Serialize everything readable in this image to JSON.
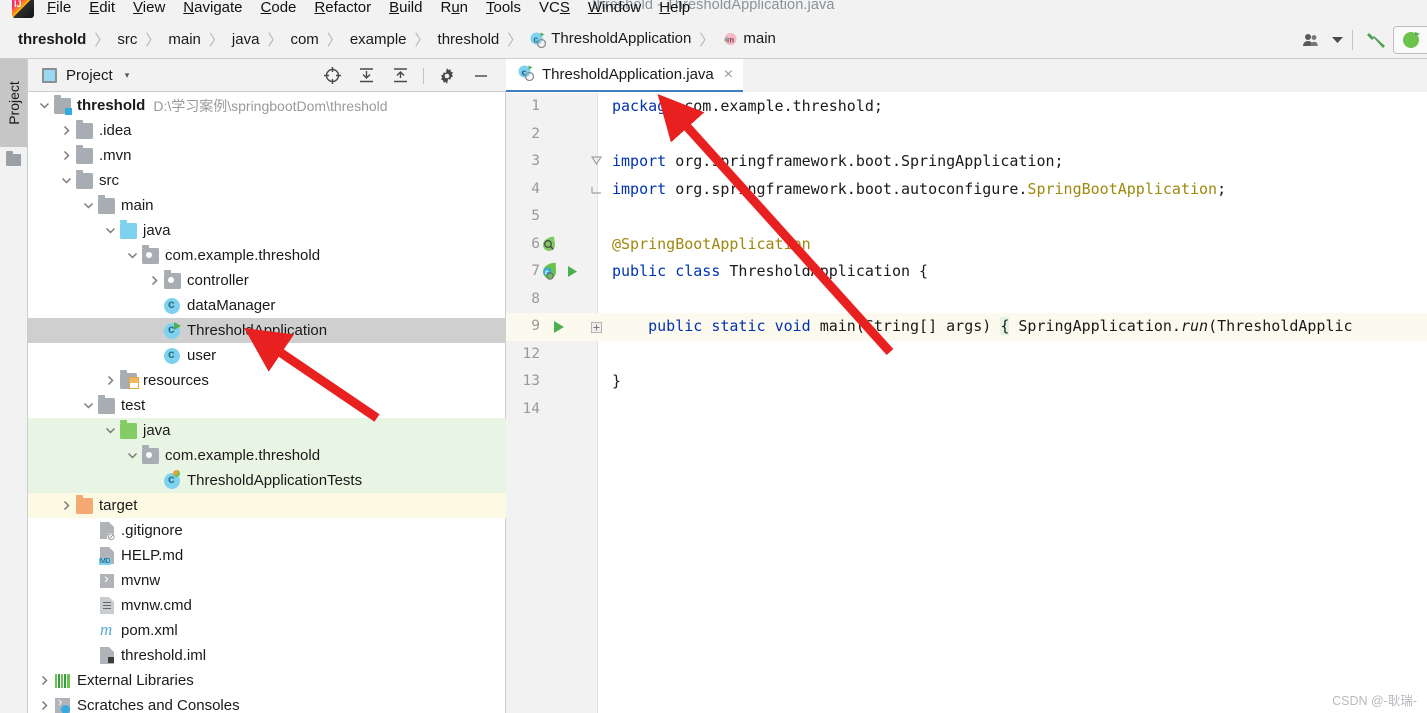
{
  "window": {
    "title": "threshold - ThresholdApplication.java"
  },
  "menubar": {
    "items": [
      {
        "label": "File",
        "mnemonic": "F"
      },
      {
        "label": "Edit",
        "mnemonic": "E"
      },
      {
        "label": "View",
        "mnemonic": "V"
      },
      {
        "label": "Navigate",
        "mnemonic": "N"
      },
      {
        "label": "Code",
        "mnemonic": "C"
      },
      {
        "label": "Refactor",
        "mnemonic": "R"
      },
      {
        "label": "Build",
        "mnemonic": "B"
      },
      {
        "label": "Run",
        "mnemonic": "u"
      },
      {
        "label": "Tools",
        "mnemonic": "T"
      },
      {
        "label": "VCS",
        "mnemonic": "S"
      },
      {
        "label": "Window",
        "mnemonic": "W"
      },
      {
        "label": "Help",
        "mnemonic": "H"
      }
    ]
  },
  "breadcrumb": {
    "items": [
      {
        "label": "threshold",
        "bold": true,
        "icon": null
      },
      {
        "label": "src",
        "bold": false,
        "icon": null
      },
      {
        "label": "main",
        "bold": false,
        "icon": null
      },
      {
        "label": "java",
        "bold": false,
        "icon": null
      },
      {
        "label": "com",
        "bold": false,
        "icon": null
      },
      {
        "label": "example",
        "bold": false,
        "icon": null
      },
      {
        "label": "threshold",
        "bold": false,
        "icon": null
      },
      {
        "label": "ThresholdApplication",
        "bold": false,
        "icon": "java-class-run-icon"
      },
      {
        "label": "main",
        "bold": false,
        "icon": "method-icon"
      }
    ],
    "separator": "〉"
  },
  "toolbar_right": {
    "user_icon": "user-group-icon",
    "user_caret": "▾",
    "build_icon": "build-hammer-icon",
    "run_icon": "run-configuration-icon"
  },
  "left_strip": {
    "project_tab": "Project"
  },
  "project_panel": {
    "title": "Project",
    "caret": "▾",
    "icons": [
      {
        "name": "locate-icon",
        "glyph": "⊕"
      },
      {
        "name": "expand-all-icon",
        "glyph": "⤓"
      },
      {
        "name": "collapse-all-icon",
        "glyph": "⤒"
      },
      {
        "name": "settings-gear-icon",
        "glyph": "⚙"
      },
      {
        "name": "hide-panel-icon",
        "glyph": "—"
      }
    ],
    "tree": [
      {
        "label": "threshold",
        "sub": "D:\\学习案例\\springbootDom\\threshold",
        "indent": 0,
        "arrow": "down",
        "icon": "module-folder",
        "bold": true,
        "hl": "none"
      },
      {
        "label": ".idea",
        "sub": "",
        "indent": 1,
        "arrow": "right",
        "icon": "folder-gray",
        "bold": false,
        "hl": "none"
      },
      {
        "label": ".mvn",
        "sub": "",
        "indent": 1,
        "arrow": "right",
        "icon": "folder-gray",
        "bold": false,
        "hl": "none"
      },
      {
        "label": "src",
        "sub": "",
        "indent": 1,
        "arrow": "down",
        "icon": "folder-gray",
        "bold": false,
        "hl": "none"
      },
      {
        "label": "main",
        "sub": "",
        "indent": 2,
        "arrow": "down",
        "icon": "folder-gray",
        "bold": false,
        "hl": "none"
      },
      {
        "label": "java",
        "sub": "",
        "indent": 3,
        "arrow": "down",
        "icon": "folder-blue",
        "bold": false,
        "hl": "none"
      },
      {
        "label": "com.example.threshold",
        "sub": "",
        "indent": 4,
        "arrow": "down",
        "icon": "package",
        "bold": false,
        "hl": "none"
      },
      {
        "label": "controller",
        "sub": "",
        "indent": 5,
        "arrow": "right",
        "icon": "package",
        "bold": false,
        "hl": "none"
      },
      {
        "label": "dataManager",
        "sub": "",
        "indent": 5,
        "arrow": "none",
        "icon": "class",
        "bold": false,
        "hl": "none"
      },
      {
        "label": "ThresholdApplication",
        "sub": "",
        "indent": 5,
        "arrow": "none",
        "icon": "class-run",
        "bold": false,
        "hl": "selected"
      },
      {
        "label": "user",
        "sub": "",
        "indent": 5,
        "arrow": "none",
        "icon": "class",
        "bold": false,
        "hl": "none"
      },
      {
        "label": "resources",
        "sub": "",
        "indent": 3,
        "arrow": "right",
        "icon": "folder-resources",
        "bold": false,
        "hl": "none"
      },
      {
        "label": "test",
        "sub": "",
        "indent": 2,
        "arrow": "down",
        "icon": "folder-gray",
        "bold": false,
        "hl": "none"
      },
      {
        "label": "java",
        "sub": "",
        "indent": 3,
        "arrow": "down",
        "icon": "folder-green",
        "bold": false,
        "hl": "green"
      },
      {
        "label": "com.example.threshold",
        "sub": "",
        "indent": 4,
        "arrow": "down",
        "icon": "package",
        "bold": false,
        "hl": "green"
      },
      {
        "label": "ThresholdApplicationTests",
        "sub": "",
        "indent": 5,
        "arrow": "none",
        "icon": "class-test",
        "bold": false,
        "hl": "green"
      },
      {
        "label": "target",
        "sub": "",
        "indent": 1,
        "arrow": "right",
        "icon": "folder-orange",
        "bold": false,
        "hl": "yellow"
      },
      {
        "label": ".gitignore",
        "sub": "",
        "indent": 2,
        "arrow": "none",
        "icon": "file-gitignore",
        "bold": false,
        "hl": "none"
      },
      {
        "label": "HELP.md",
        "sub": "",
        "indent": 2,
        "arrow": "none",
        "icon": "file-md",
        "bold": false,
        "hl": "none"
      },
      {
        "label": "mvnw",
        "sub": "",
        "indent": 2,
        "arrow": "none",
        "icon": "file-script",
        "bold": false,
        "hl": "none"
      },
      {
        "label": "mvnw.cmd",
        "sub": "",
        "indent": 2,
        "arrow": "none",
        "icon": "file-cmd",
        "bold": false,
        "hl": "none"
      },
      {
        "label": "pom.xml",
        "sub": "",
        "indent": 2,
        "arrow": "none",
        "icon": "file-maven",
        "bold": false,
        "hl": "none"
      },
      {
        "label": "threshold.iml",
        "sub": "",
        "indent": 2,
        "arrow": "none",
        "icon": "file-iml",
        "bold": false,
        "hl": "none"
      },
      {
        "label": "External Libraries",
        "sub": "",
        "indent": 0,
        "arrow": "right",
        "icon": "external-libraries",
        "bold": false,
        "hl": "none"
      },
      {
        "label": "Scratches and Consoles",
        "sub": "",
        "indent": 0,
        "arrow": "right",
        "icon": "scratches",
        "bold": false,
        "hl": "none"
      }
    ]
  },
  "editor": {
    "tab": {
      "label": "ThresholdApplication.java",
      "icon": "java-class-run-icon",
      "close": "×"
    },
    "lines": [
      {
        "num": "1",
        "html": "<span class=\"k\">package</span> com.example.threshold;",
        "gutter": "",
        "hl": false
      },
      {
        "num": "2",
        "html": "",
        "gutter": "",
        "hl": false
      },
      {
        "num": "3",
        "html": "<span class=\"k\">import</span> org.springframework.boot.SpringApplication;",
        "gutter": "fold-open",
        "hl": false
      },
      {
        "num": "4",
        "html": "<span class=\"k\">import</span> org.springframework.boot.autoconfigure.<span class=\"ann\">SpringBootApplication</span>;",
        "gutter": "fold-close",
        "hl": false
      },
      {
        "num": "5",
        "html": "",
        "gutter": "",
        "hl": false
      },
      {
        "num": "6",
        "html": "<span class=\"ann\">@SpringBootApplication</span>",
        "gutter": "bean-icon",
        "hl": false
      },
      {
        "num": "7",
        "html": "<span class=\"k\">public</span> <span class=\"k\">class</span> ThresholdApplication {",
        "gutter": "spring-run-icon",
        "hl": false
      },
      {
        "num": "8",
        "html": "",
        "gutter": "",
        "hl": false
      },
      {
        "num": "9",
        "html": "    <span class=\"k\">public</span> <span class=\"k\">static</span> <span class=\"k\">void</span> main(String[] args) <span class=\"bracehl\">{</span> SpringApplication.<span class=\"ital\">run</span>(ThresholdApplic",
        "gutter": "run-method-icon",
        "hl": true
      },
      {
        "num": "12",
        "html": "",
        "gutter": "",
        "hl": false
      },
      {
        "num": "13",
        "html": "}",
        "gutter": "",
        "hl": false
      },
      {
        "num": "14",
        "html": "",
        "gutter": "",
        "hl": false
      }
    ]
  },
  "watermark": {
    "text": "CSDN @-耿瑞-"
  },
  "colors": {
    "accent": "#3d7fc1",
    "keyword": "#0033b3",
    "annotation": "#9e880d",
    "selected_row": "#cfcfcf",
    "test_scope": "#e9f5e4",
    "excluded_scope": "#fdfae3",
    "current_line": "#fcfaee",
    "arrow": "#e8201f"
  }
}
